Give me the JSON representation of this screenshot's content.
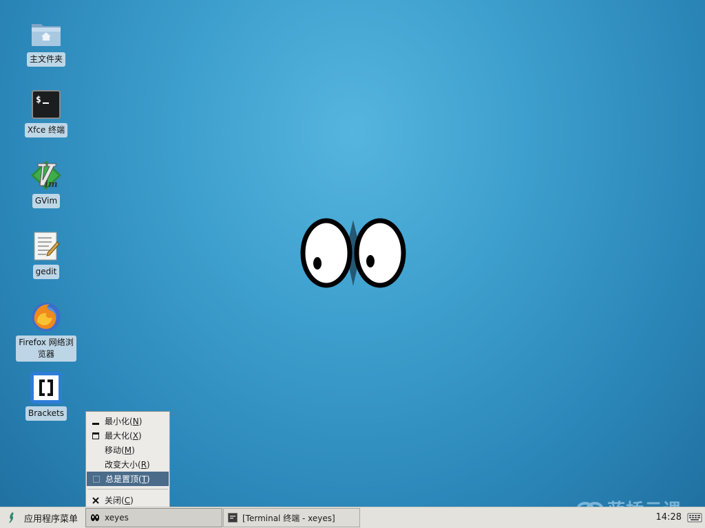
{
  "desktop": {
    "icons": [
      {
        "label": "主文件夹"
      },
      {
        "label": "Xfce 终端"
      },
      {
        "label": "GVim"
      },
      {
        "label": "gedit"
      },
      {
        "label": "Firefox 网络浏览器"
      },
      {
        "label": "Brackets"
      }
    ]
  },
  "window_menu": {
    "items": [
      {
        "label": "最小化",
        "mnemonic": "N",
        "icon": "minimize-icon"
      },
      {
        "label": "最大化",
        "mnemonic": "X",
        "icon": "maximize-icon"
      },
      {
        "label": "移动",
        "mnemonic": "M",
        "icon": ""
      },
      {
        "label": "改变大小",
        "mnemonic": "R",
        "icon": ""
      },
      {
        "label": "总是置顶",
        "mnemonic": "T",
        "icon": "checkbox-icon",
        "selected": true
      },
      {
        "label": "关闭",
        "mnemonic": "C",
        "icon": "close-icon"
      }
    ]
  },
  "taskbar": {
    "app_menu_label": "应用程序菜单",
    "tasks": [
      {
        "label": "xeyes",
        "active": true
      },
      {
        "label": "[Terminal 终端 - xeyes]",
        "active": false
      }
    ],
    "clock": "14:28"
  },
  "watermark": {
    "text": "蓝桥云课"
  },
  "colors": {
    "desktop_bg": "#3d9fcd",
    "menu_highlight": "#4a6b8a",
    "panel_bg": "#e4e2dc"
  }
}
